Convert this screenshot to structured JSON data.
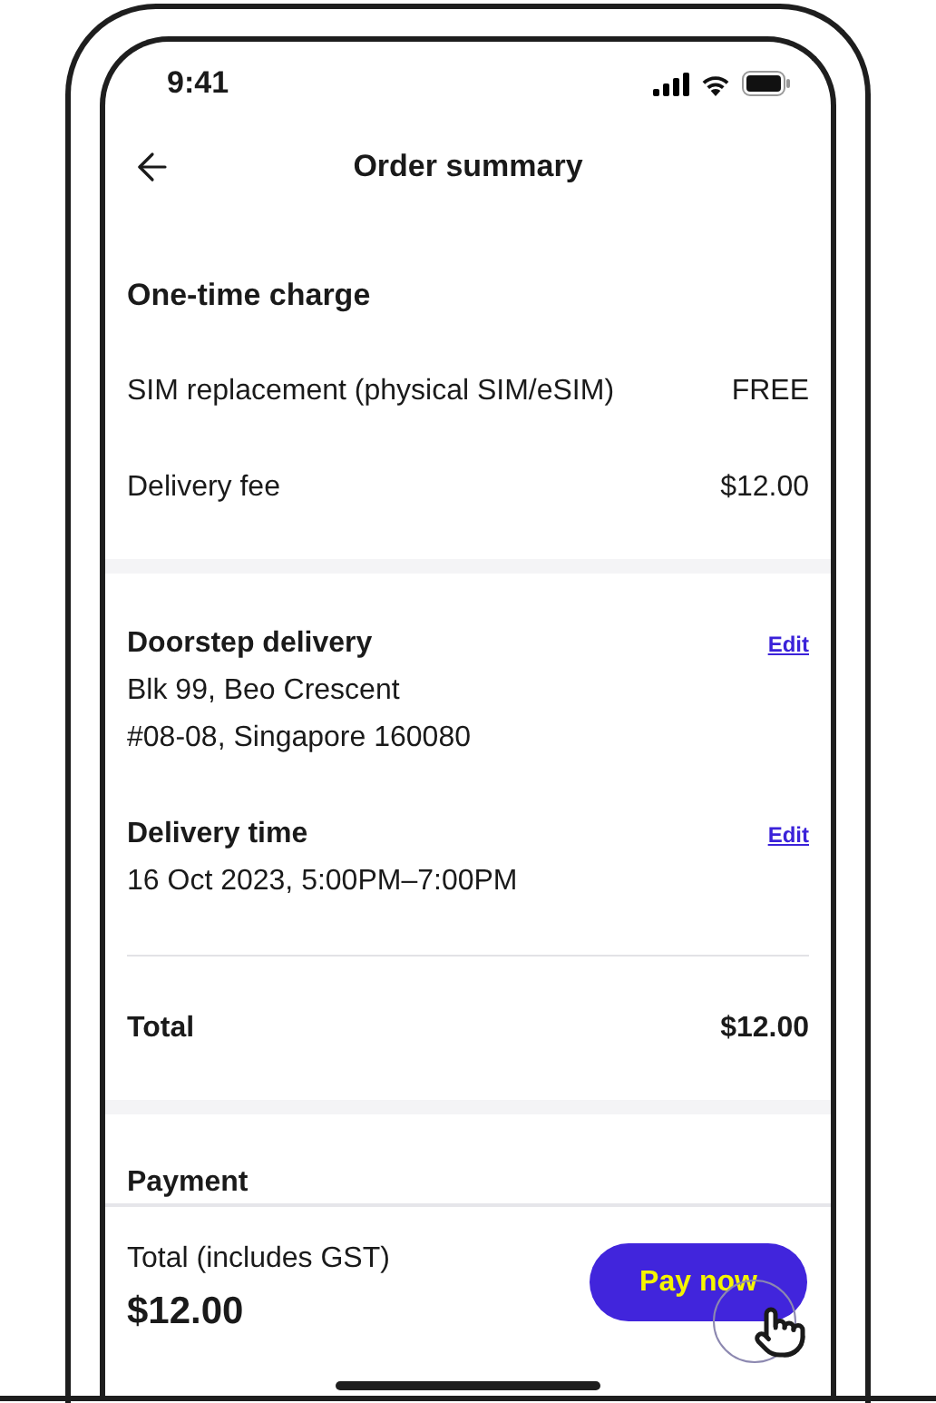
{
  "status_bar": {
    "time": "9:41"
  },
  "header": {
    "title": "Order summary"
  },
  "one_time_charge": {
    "title": "One-time charge",
    "rows": [
      {
        "label": "SIM replacement (physical SIM/eSIM)",
        "value": "FREE"
      },
      {
        "label": "Delivery fee",
        "value": "$12.00"
      }
    ]
  },
  "delivery": {
    "sections": [
      {
        "title": "Doorstep delivery",
        "action": "Edit",
        "lines": [
          "Blk 99, Beo Crescent",
          "#08-08, Singapore 160080"
        ]
      },
      {
        "title": "Delivery time",
        "action": "Edit",
        "lines": [
          "16 Oct 2023, 5:00PM–7:00PM"
        ]
      }
    ],
    "total": {
      "label": "Total",
      "value": "$12.00"
    }
  },
  "payment": {
    "title": "Payment"
  },
  "footer": {
    "label": "Total (includes GST)",
    "amount": "$12.00",
    "button": "Pay now"
  }
}
